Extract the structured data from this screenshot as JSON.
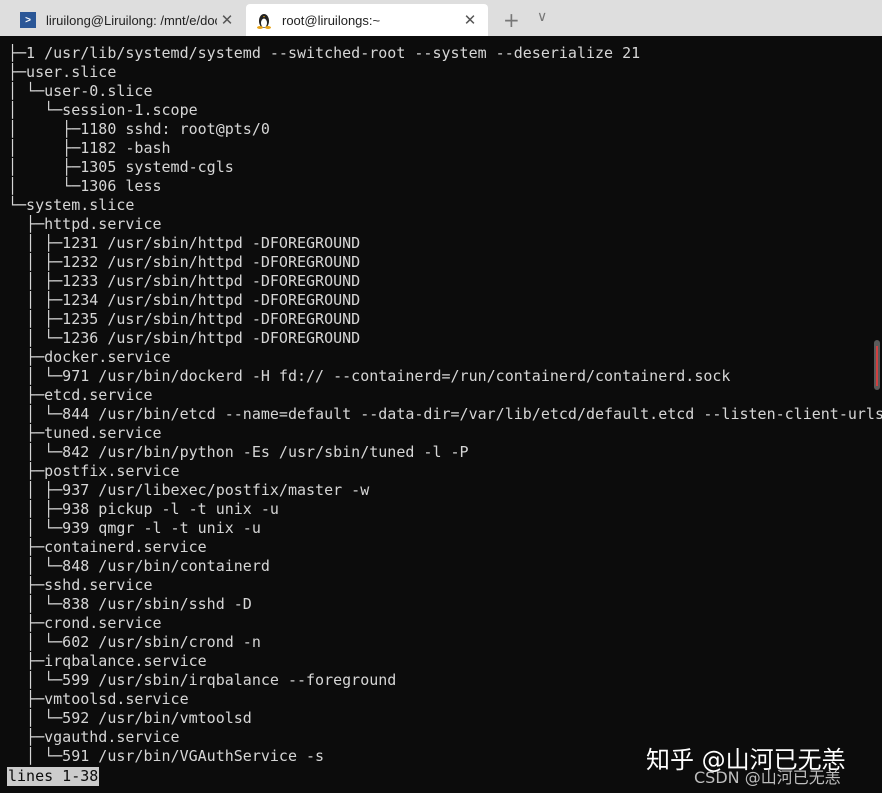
{
  "tabs": [
    {
      "title": "liruilong@Liruilong: /mnt/e/doc",
      "icon": "powershell-icon",
      "active": false
    },
    {
      "title": "root@liruilongs:~",
      "icon": "linux-penguin-icon",
      "active": true
    }
  ],
  "tabbar": {
    "new_tab": "+",
    "dropdown": "∨",
    "close": "✕"
  },
  "terminal": {
    "lines": [
      "├─1 /usr/lib/systemd/systemd --switched-root --system --deserialize 21",
      "├─user.slice",
      "│ └─user-0.slice",
      "│   └─session-1.scope",
      "│     ├─1180 sshd: root@pts/0",
      "│     ├─1182 -bash",
      "│     ├─1305 systemd-cgls",
      "│     └─1306 less",
      "└─system.slice",
      "  ├─httpd.service",
      "  │ ├─1231 /usr/sbin/httpd -DFOREGROUND",
      "  │ ├─1232 /usr/sbin/httpd -DFOREGROUND",
      "  │ ├─1233 /usr/sbin/httpd -DFOREGROUND",
      "  │ ├─1234 /usr/sbin/httpd -DFOREGROUND",
      "  │ ├─1235 /usr/sbin/httpd -DFOREGROUND",
      "  │ └─1236 /usr/sbin/httpd -DFOREGROUND",
      "  ├─docker.service",
      "  │ └─971 /usr/bin/dockerd -H fd:// --containerd=/run/containerd/containerd.sock",
      "  ├─etcd.service",
      "  │ └─844 /usr/bin/etcd --name=default --data-dir=/var/lib/etcd/default.etcd --listen-client-urls",
      "  ├─tuned.service",
      "  │ └─842 /usr/bin/python -Es /usr/sbin/tuned -l -P",
      "  ├─postfix.service",
      "  │ ├─937 /usr/libexec/postfix/master -w",
      "  │ ├─938 pickup -l -t unix -u",
      "  │ └─939 qmgr -l -t unix -u",
      "  ├─containerd.service",
      "  │ └─848 /usr/bin/containerd",
      "  ├─sshd.service",
      "  │ └─838 /usr/sbin/sshd -D",
      "  ├─crond.service",
      "  │ └─602 /usr/sbin/crond -n",
      "  ├─irqbalance.service",
      "  │ └─599 /usr/sbin/irqbalance --foreground",
      "  ├─vmtoolsd.service",
      "  │ └─592 /usr/bin/vmtoolsd",
      "  ├─vgauthd.service",
      "  │ └─591 /usr/bin/VGAuthService -s"
    ],
    "status": "lines 1-38"
  },
  "watermarks": {
    "zhihu": "知乎 @山河已无恙",
    "csdn": "CSDN @山河已无恙"
  },
  "colors": {
    "background": "#0c0c0c",
    "foreground": "#d6d6d6",
    "scroll_accent": "#d04040"
  }
}
